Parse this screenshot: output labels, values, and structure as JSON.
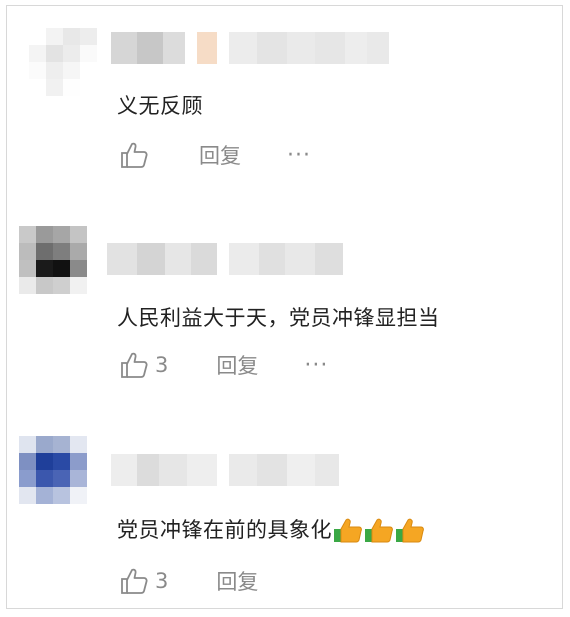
{
  "comments": [
    {
      "text": "义无反顾",
      "like_count": "",
      "reply_label": "回复",
      "more_label": "···"
    },
    {
      "text": "人民利益大于天，党员冲锋显担当",
      "like_count": "3",
      "reply_label": "回复",
      "more_label": "···"
    },
    {
      "text": "党员冲锋在前的具象化",
      "like_count": "3",
      "reply_label": "回复"
    }
  ],
  "colors": {
    "text": "#222222",
    "meta": "#8a8a8a",
    "border": "#d8d8d8"
  }
}
